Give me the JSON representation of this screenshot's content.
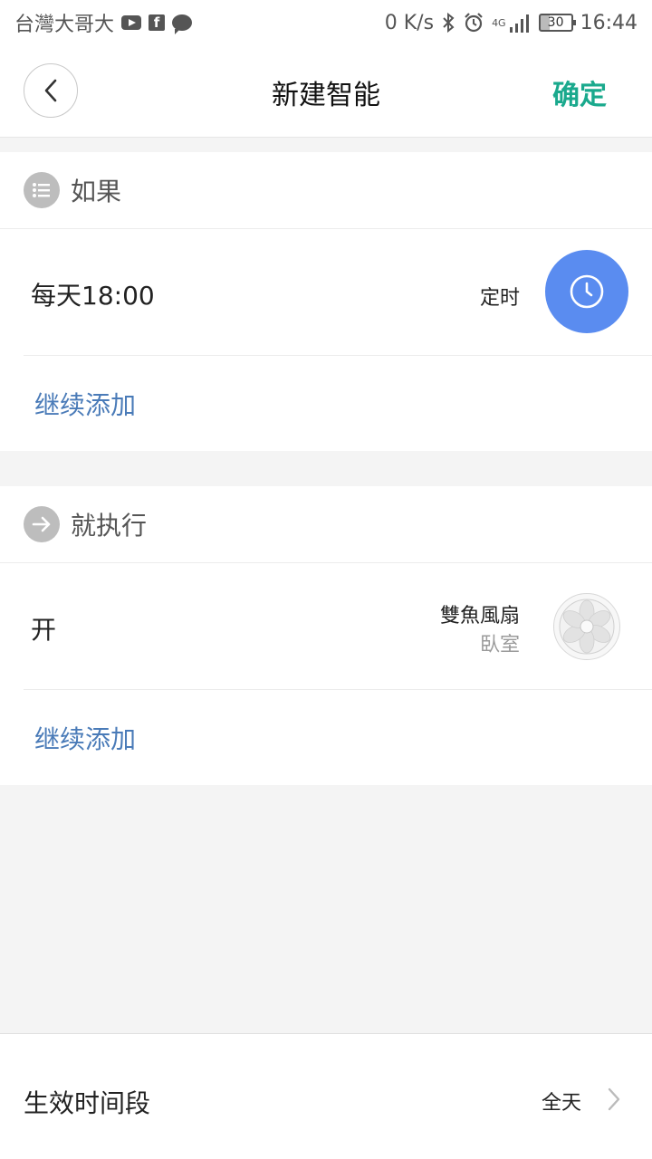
{
  "status_bar": {
    "carrier": "台灣大哥大",
    "net_speed": "0 K/s",
    "network": "4G",
    "battery": "30",
    "time": "16:44",
    "icons": [
      "youtube-icon",
      "facebook-icon",
      "message-icon",
      "bluetooth-icon",
      "alarm-icon",
      "signal-icon",
      "battery-icon"
    ]
  },
  "header": {
    "title": "新建智能",
    "confirm_label": "确定"
  },
  "if_section": {
    "title": "如果",
    "condition": "每天18:00",
    "condition_type": "定时",
    "add_label": "继续添加"
  },
  "then_section": {
    "title": "就执行",
    "action": "开",
    "device_name": "雙魚風扇",
    "device_room": "臥室",
    "add_label": "继续添加"
  },
  "bottom": {
    "period_label": "生效时间段",
    "period_value": "全天"
  },
  "colors": {
    "accent": "#1aa98d",
    "link": "#4a7bb8",
    "timer_button": "#5a8cf0",
    "background": "#f4f4f4"
  }
}
